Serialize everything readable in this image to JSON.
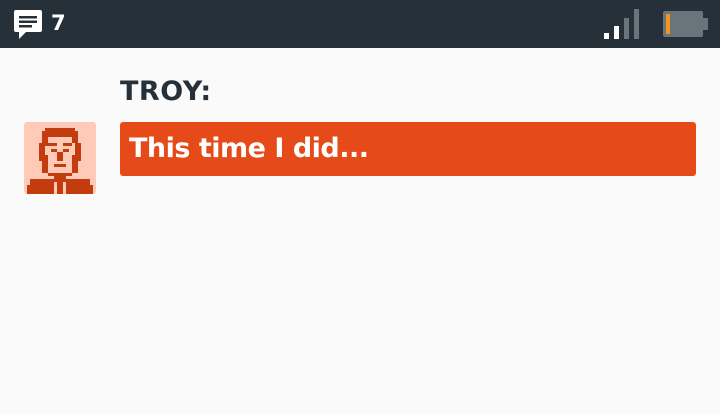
{
  "status_bar": {
    "message_count": "7",
    "message_icon": "chat-bubble-icon",
    "signal_icon": "signal-strength-icon",
    "battery_icon": "battery-low-icon",
    "signal_level": 0.5,
    "battery_level": 0.1
  },
  "dialogue": {
    "speaker": "TROY:",
    "text": "This time I did...",
    "avatar_icon": "troy-portrait"
  },
  "colors": {
    "status_bar_bg": "#263038",
    "page_bg": "#fafafa",
    "bubble_bg": "#e64a19",
    "speaker_text": "#263038",
    "battery_fill": "#f7941d",
    "avatar_bg": "#ffcbb8",
    "avatar_ink": "#c23c0e"
  }
}
